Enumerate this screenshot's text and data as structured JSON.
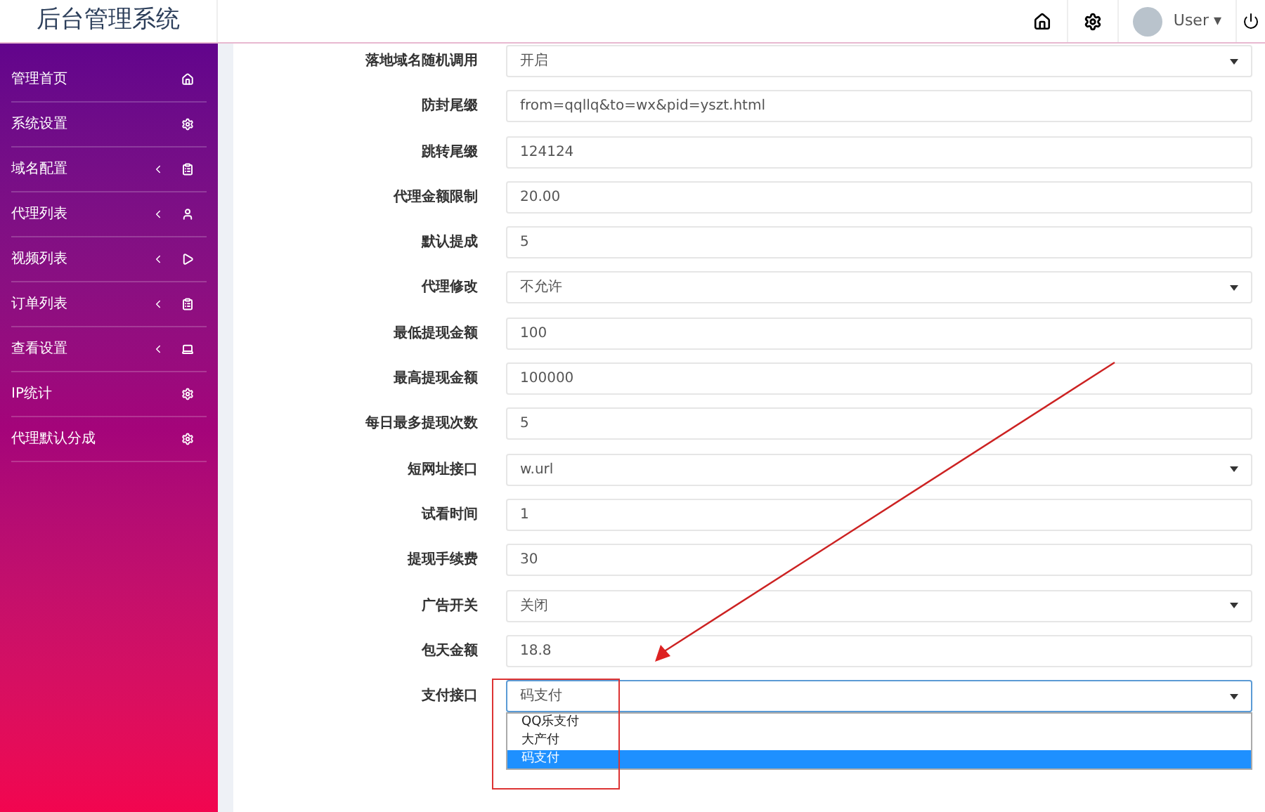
{
  "header": {
    "title": "后台管理系统",
    "user": {
      "name": "User",
      "caret": "▾"
    }
  },
  "sidebar": {
    "items": [
      {
        "label": "管理首页",
        "expandable": false
      },
      {
        "label": "系统设置",
        "expandable": false
      },
      {
        "label": "域名配置",
        "expandable": true
      },
      {
        "label": "代理列表",
        "expandable": true
      },
      {
        "label": "视频列表",
        "expandable": true
      },
      {
        "label": "订单列表",
        "expandable": true
      },
      {
        "label": "查看设置",
        "expandable": true
      },
      {
        "label": "IP统计",
        "expandable": false
      },
      {
        "label": "代理默认分成",
        "expandable": false
      }
    ]
  },
  "form": {
    "fields": [
      {
        "label": "落地域名随机调用",
        "kind": "select",
        "value": "开启"
      },
      {
        "label": "防封尾缀",
        "kind": "text",
        "value": "from=qqllq&to=wx&pid=yszt.html"
      },
      {
        "label": "跳转尾缀",
        "kind": "text",
        "value": "124124"
      },
      {
        "label": "代理金额限制",
        "kind": "text",
        "value": "20.00"
      },
      {
        "label": "默认提成",
        "kind": "text",
        "value": "5"
      },
      {
        "label": "代理修改",
        "kind": "select",
        "value": "不允许"
      },
      {
        "label": "最低提现金额",
        "kind": "text",
        "value": "100"
      },
      {
        "label": "最高提现金额",
        "kind": "text",
        "value": "100000"
      },
      {
        "label": "每日最多提现次数",
        "kind": "text",
        "value": "5"
      },
      {
        "label": "短网址接口",
        "kind": "select",
        "value": "w.url"
      },
      {
        "label": "试看时间",
        "kind": "text",
        "value": "1"
      },
      {
        "label": "提现手续费",
        "kind": "text",
        "value": "30"
      },
      {
        "label": "广告开关",
        "kind": "select",
        "value": "关闭"
      },
      {
        "label": "包天金额",
        "kind": "text",
        "value": "18.8"
      },
      {
        "label": "支付接口",
        "kind": "select",
        "value": "码支付",
        "open": true,
        "options": [
          {
            "label": "QQ乐支付",
            "selected": false
          },
          {
            "label": "大产付",
            "selected": false
          },
          {
            "label": "码支付",
            "selected": true
          }
        ]
      }
    ]
  }
}
